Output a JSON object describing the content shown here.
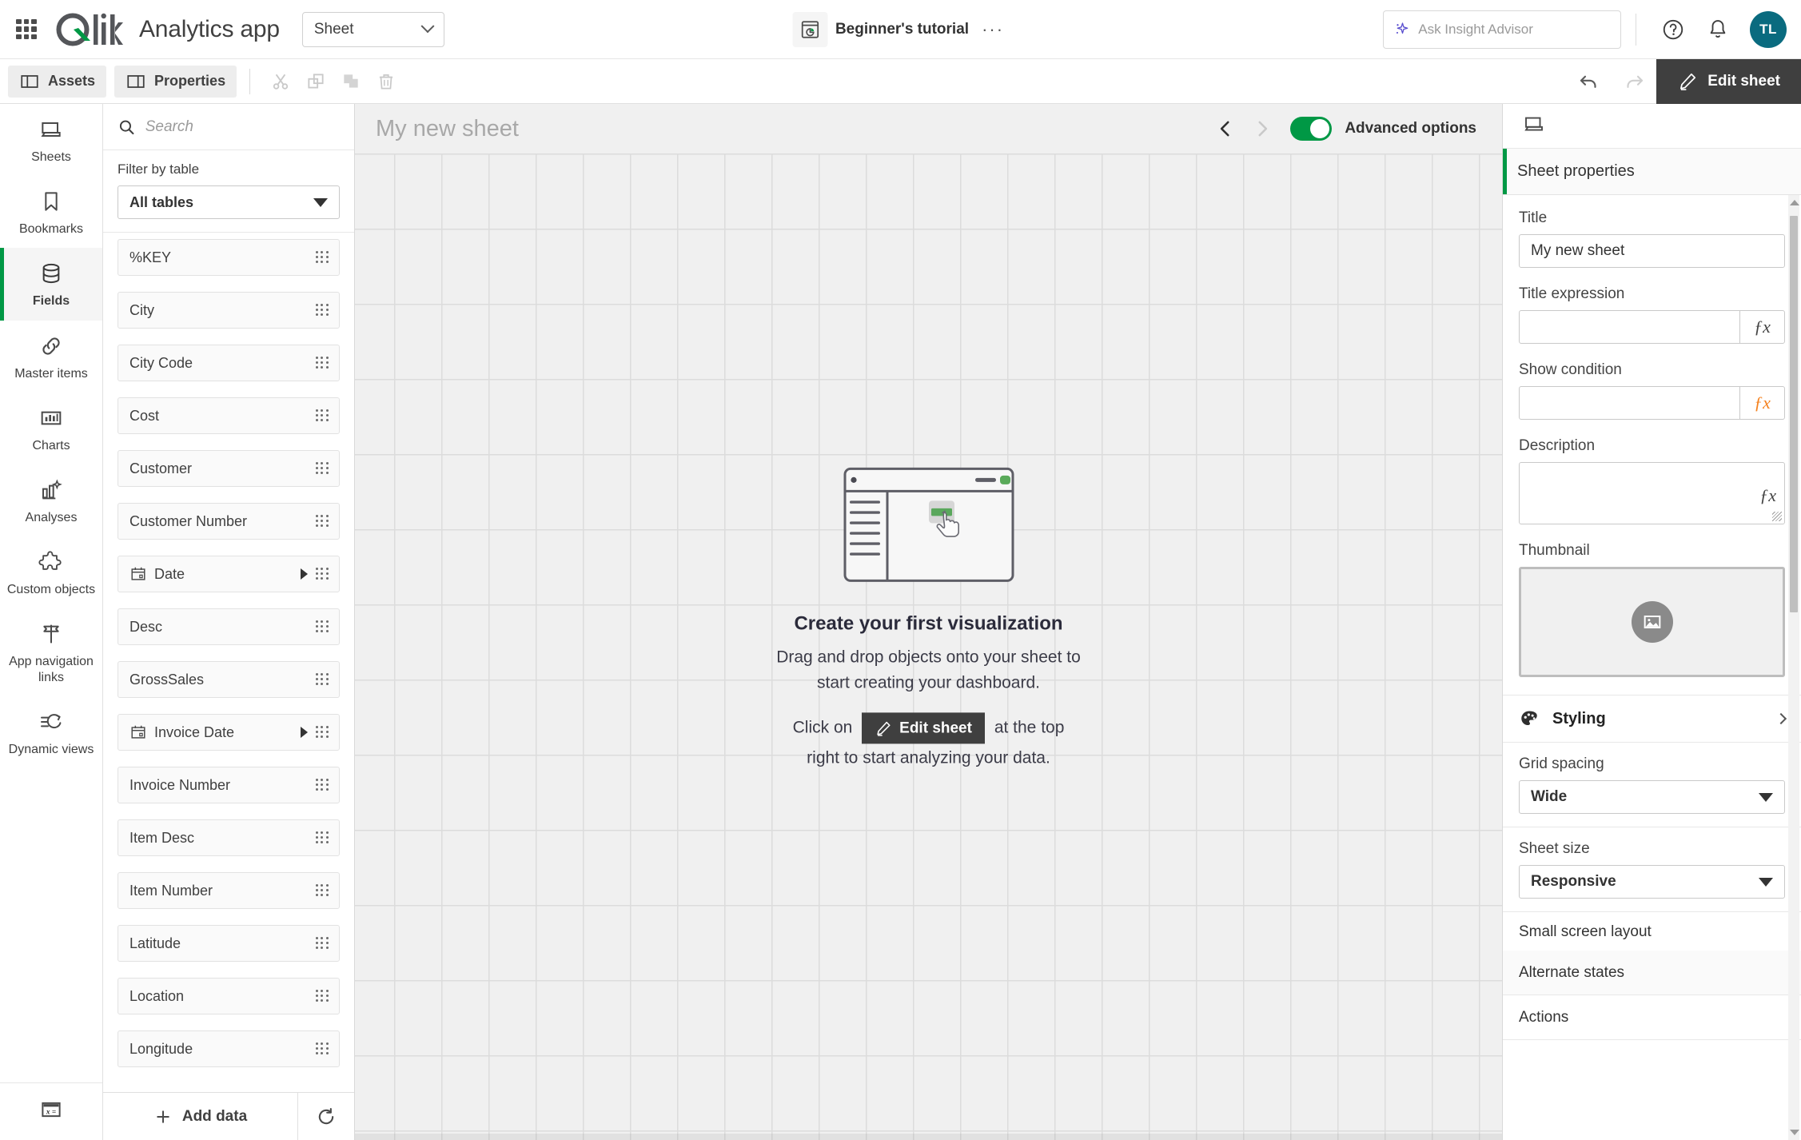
{
  "header": {
    "logo_text": "Qlik",
    "app_title": "Analytics app",
    "sheet_dropdown": "Sheet",
    "doc_name": "Beginner's tutorial",
    "overflow_menu": "···",
    "insight_placeholder": "Ask Insight Advisor",
    "insight_value": "",
    "avatar_initials": "TL"
  },
  "toolbar": {
    "assets_label": "Assets",
    "properties_label": "Properties",
    "cut_label": "Cut",
    "copy_label": "Copy",
    "paste_label": "Paste",
    "delete_label": "Delete",
    "undo_label": "Undo",
    "redo_label": "Redo",
    "edit_sheet_label": "Edit sheet"
  },
  "rail": {
    "items": [
      {
        "label": "Sheets",
        "icon": "sheet-icon",
        "active": false
      },
      {
        "label": "Bookmarks",
        "icon": "bookmark-icon",
        "active": false
      },
      {
        "label": "Fields",
        "icon": "database-icon",
        "active": true
      },
      {
        "label": "Master items",
        "icon": "link-icon",
        "active": false
      },
      {
        "label": "Charts",
        "icon": "bar-chart-icon",
        "active": false
      },
      {
        "label": "Analyses",
        "icon": "analyses-icon",
        "active": false
      },
      {
        "label": "Custom objects",
        "icon": "puzzle-icon",
        "active": false
      },
      {
        "label": "App navigation links",
        "icon": "signpost-icon",
        "active": false
      },
      {
        "label": "Dynamic views",
        "icon": "dynamic-views-icon",
        "active": false
      }
    ],
    "bottom_icon": "expression-icon"
  },
  "assets": {
    "search_placeholder": "Search",
    "search_value": "",
    "filter_label": "Filter by table",
    "filter_value": "All tables",
    "fields": [
      {
        "name": "%KEY",
        "type": "plain"
      },
      {
        "name": "City",
        "type": "plain"
      },
      {
        "name": "City Code",
        "type": "plain"
      },
      {
        "name": "Cost",
        "type": "plain"
      },
      {
        "name": "Customer",
        "type": "plain"
      },
      {
        "name": "Customer Number",
        "type": "plain"
      },
      {
        "name": "Date",
        "type": "date"
      },
      {
        "name": "Desc",
        "type": "plain"
      },
      {
        "name": "GrossSales",
        "type": "plain"
      },
      {
        "name": "Invoice Date",
        "type": "date"
      },
      {
        "name": "Invoice Number",
        "type": "plain"
      },
      {
        "name": "Item Desc",
        "type": "plain"
      },
      {
        "name": "Item Number",
        "type": "plain"
      },
      {
        "name": "Latitude",
        "type": "plain"
      },
      {
        "name": "Location",
        "type": "plain"
      },
      {
        "name": "Longitude",
        "type": "plain"
      }
    ],
    "add_data_label": "Add data",
    "reload_label": "Reload data"
  },
  "canvas": {
    "sheet_title": "My new sheet",
    "prev_label": "Previous sheet",
    "next_label": "Next sheet",
    "advanced_options_label": "Advanced options",
    "advanced_options_on": true,
    "empty_state": {
      "title": "Create your first visualization",
      "line1": "Drag and drop objects onto your sheet to",
      "line2": "start creating your dashboard.",
      "line3_prefix": "Click on",
      "button_label": "Edit sheet",
      "line3_suffix": "at the top",
      "line4": "right to start analyzing your data."
    }
  },
  "properties": {
    "panel_tab_icon": "sheet-icon",
    "section_title": "Sheet properties",
    "title_label": "Title",
    "title_value": "My new sheet",
    "title_expression_label": "Title expression",
    "title_expression_value": "",
    "show_condition_label": "Show condition",
    "show_condition_value": "",
    "description_label": "Description",
    "description_value": "",
    "thumbnail_label": "Thumbnail",
    "styling_label": "Styling",
    "grid_spacing_label": "Grid spacing",
    "grid_spacing_value": "Wide",
    "sheet_size_label": "Sheet size",
    "sheet_size_value": "Responsive",
    "small_screen_layout_label": "Small screen layout",
    "alternate_states_label": "Alternate states",
    "actions_label": "Actions",
    "fx_symbol": "ƒx"
  },
  "colors": {
    "brand_green": "#009845",
    "accent_dark": "#3f3f3f",
    "avatar_bg": "#0a6b7f",
    "orange_fx": "#f5821f",
    "canvas_bg": "#f0f0f0"
  }
}
